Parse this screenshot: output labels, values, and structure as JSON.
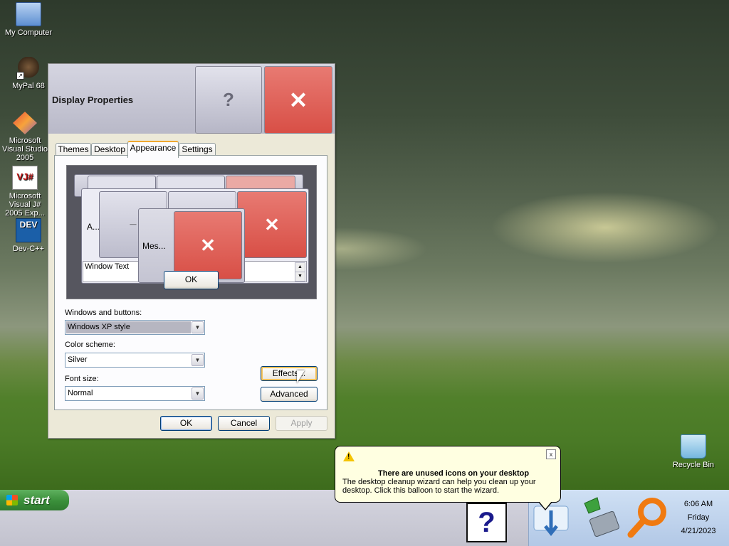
{
  "desktop": {
    "icons": [
      {
        "label": "My Computer"
      },
      {
        "label": "MyPal 68"
      },
      {
        "label": "Microsoft Visual Studio 2005"
      },
      {
        "label": "Microsoft Visual J# 2005 Exp..."
      },
      {
        "label": "Dev-C++"
      },
      {
        "label": "Recycle Bin"
      }
    ],
    "icon_glyphs": {
      "vj": "VJ#",
      "dev": "DEV"
    }
  },
  "window": {
    "title": "Display Properties",
    "help_glyph": "?",
    "close_glyph": "✕",
    "tabs": [
      {
        "label": "Themes"
      },
      {
        "label": "Desktop"
      },
      {
        "label": "Appearance"
      },
      {
        "label": "Settings"
      }
    ],
    "active_tab": "Appearance",
    "preview": {
      "active_window_label": "A...",
      "message_label": "Mes...",
      "window_text": "Window Text",
      "ok": "OK",
      "minimize_glyph": "_",
      "close_glyph": "✕"
    },
    "windows_buttons": {
      "label": "Windows and buttons:",
      "value": "Windows XP style"
    },
    "color_scheme": {
      "label": "Color scheme:",
      "value": "Silver"
    },
    "font_size": {
      "label": "Font size:",
      "value": "Normal"
    },
    "effects_button": "Effects...",
    "advanced_button": "Advanced",
    "ok_button": "OK",
    "cancel_button": "Cancel",
    "apply_button": "Apply"
  },
  "taskbar": {
    "start_label": "start",
    "help_glyph": "?",
    "clock": {
      "time": "6:06 AM",
      "day": "Friday",
      "date": "4/21/2023"
    }
  },
  "balloon": {
    "title": "There are unused icons on your desktop",
    "body": "The desktop cleanup wizard can help you clean up your desktop. Click this balloon to start the wizard.",
    "close_glyph": "x",
    "warning_glyph": "!"
  },
  "colors": {
    "close_red": "#d84f46",
    "silver_title": "#c6c6d4",
    "tab_highlight": "#f0a830",
    "start_green": "#3a8f3a",
    "balloon_bg": "#ffffe1"
  }
}
